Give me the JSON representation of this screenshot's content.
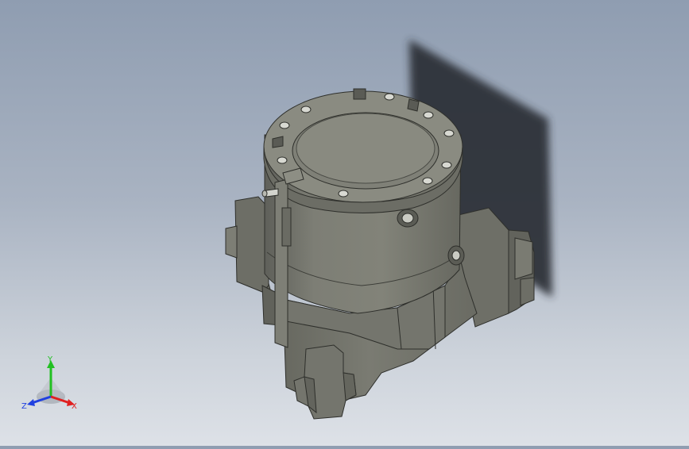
{
  "viewport": {
    "background_top": "#8f9db1",
    "background_bottom": "#dde1e7",
    "model_color": "#7b7c72",
    "shadow_color": "#2c2f34"
  },
  "triad": {
    "y_label": "Y",
    "x_label": "X",
    "z_label": "Z",
    "y_color": "#22c022",
    "x_color": "#e02020",
    "z_color": "#2040e0"
  }
}
